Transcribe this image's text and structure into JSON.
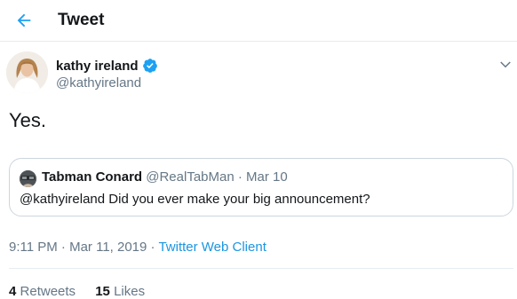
{
  "header": {
    "title": "Tweet"
  },
  "tweet": {
    "author_name": "kathy ireland",
    "author_handle": "@kathyireland",
    "verified": true,
    "text": "Yes.",
    "time": "9:11 PM",
    "sep1": " · ",
    "date": "Mar 11, 2019",
    "sep2": " · ",
    "client": "Twitter Web Client"
  },
  "quoted_tweet": {
    "author_name": "Tabman Conard",
    "author_handle": "@RealTabMan",
    "sep": " · ",
    "date": "Mar 10",
    "text": "@kathyireland Did you ever make your big announcement?"
  },
  "stats": {
    "retweets_count": "4",
    "retweets_label": "Retweets",
    "likes_count": "15",
    "likes_label": "Likes"
  },
  "icons": {
    "back": "arrow-left-icon",
    "verified": "verified-badge-icon",
    "more": "chevron-down-icon"
  },
  "colors": {
    "accent": "#1da1f2",
    "link": "#1b95e0",
    "secondary_text": "#657786",
    "border": "#e6ecf0"
  }
}
